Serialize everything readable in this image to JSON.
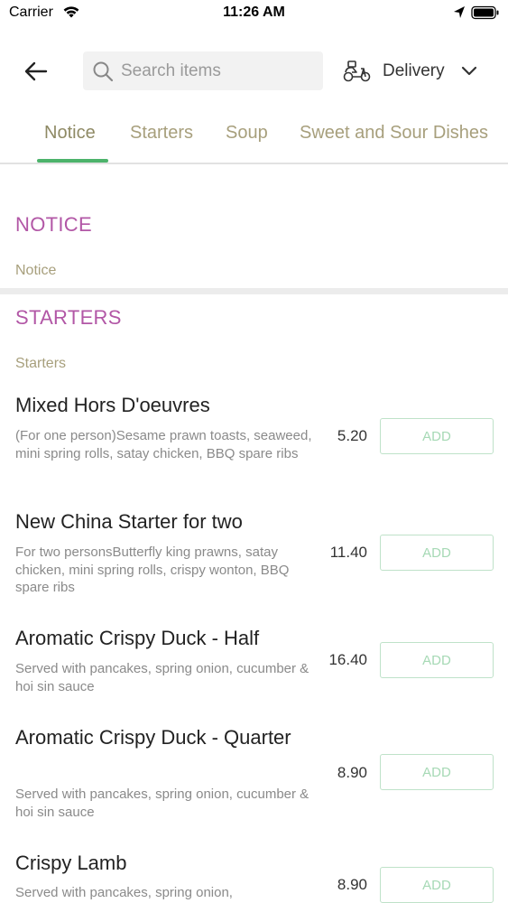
{
  "status_bar": {
    "carrier": "Carrier",
    "time": "11:26 AM"
  },
  "header": {
    "back_icon": "arrow-left-icon",
    "search": {
      "placeholder": "Search items",
      "value": ""
    },
    "delivery_label": "Delivery"
  },
  "tabs": [
    {
      "label": "Notice",
      "active": true
    },
    {
      "label": "Starters",
      "active": false
    },
    {
      "label": "Soup",
      "active": false
    },
    {
      "label": "Sweet and Sour Dishes",
      "active": false
    }
  ],
  "sections": [
    {
      "title": "NOTICE",
      "subtitle": "Notice"
    },
    {
      "title": "STARTERS",
      "subtitle": "Starters",
      "items": [
        {
          "name": "Mixed Hors D'oeuvres",
          "description": "(For one person)Sesame prawn toasts, seaweed, mini spring rolls, satay chicken, BBQ spare ribs",
          "price": "5.20",
          "button": "ADD"
        },
        {
          "name": "New China Starter for two",
          "description": "For two personsButterfly king prawns, satay chicken, mini spring rolls, crispy wonton, BBQ spare ribs",
          "price": "11.40",
          "button": "ADD"
        },
        {
          "name": "Aromatic Crispy Duck - Half",
          "description": "Served with pancakes, spring onion, cucumber &  hoi sin sauce",
          "price": "16.40",
          "button": "ADD"
        },
        {
          "name": "Aromatic Crispy Duck - Quarter",
          "description": "Served with pancakes, spring onion, cucumber & hoi sin sauce",
          "price": "8.90",
          "button": "ADD"
        },
        {
          "name": "Crispy Lamb",
          "description": "Served with pancakes, spring onion,",
          "price": "8.90",
          "button": "ADD"
        }
      ]
    }
  ],
  "colors": {
    "accent_green": "#4cb36b",
    "section_title": "#b257a6",
    "tab_text": "#a79f7c"
  }
}
